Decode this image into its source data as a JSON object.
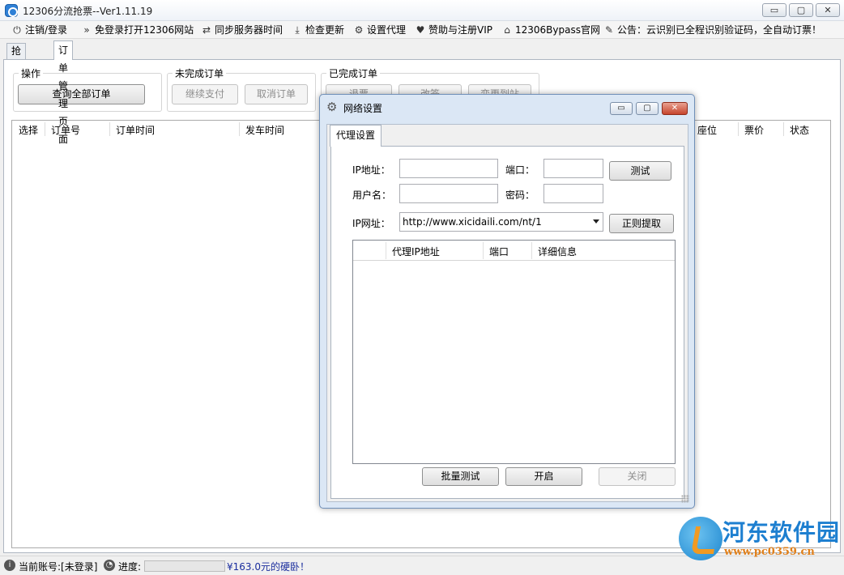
{
  "window": {
    "title": "12306分流抢票--Ver1.11.19",
    "min_glyph": "▭",
    "max_glyph": "▢",
    "close_glyph": "✕"
  },
  "toolbar": {
    "items": [
      {
        "icon": "⏻",
        "label": "注销/登录"
      },
      {
        "icon": "»",
        "label": "免登录打开12306网站"
      },
      {
        "icon": "⇄",
        "label": "同步服务器时间"
      },
      {
        "icon": "⤓",
        "label": "检查更新"
      },
      {
        "icon": "⚙",
        "label": "设置代理"
      },
      {
        "icon": "♥",
        "label": "赞助与注册VIP"
      },
      {
        "icon": "⌂",
        "label": "12306Bypass官网"
      },
      {
        "icon": "✎",
        "label": "公告：云识别已全程识别验证码，全自动订票！"
      }
    ]
  },
  "tabs": [
    {
      "label": "抢票页面",
      "active": false
    },
    {
      "label": "订单管理页面",
      "active": true
    }
  ],
  "order_page": {
    "ops_group": {
      "title": "操作",
      "query_all_button": "查询全部订单"
    },
    "unfinished_group": {
      "title": "未完成订单",
      "continue_pay_button": "继续支付",
      "cancel_order_button": "取消订单"
    },
    "finished_group": {
      "title": "已完成订单",
      "buttons": [
        "退票",
        "改签",
        "变更到站"
      ]
    },
    "columns_left": [
      "选择",
      "订单号",
      "订单时间",
      "发车时间"
    ],
    "columns_right": [
      "座位",
      "票价",
      "状态"
    ]
  },
  "statusbar": {
    "account_label": "当前账号:[未登录]",
    "progress_label": "进度:",
    "progress_value": 0,
    "marquee": "¥163.0元的硬卧！"
  },
  "dialog": {
    "title": "网络设置",
    "min_glyph": "▭",
    "max_glyph": "▢",
    "close_glyph": "✕",
    "tab_label": "代理设置",
    "ip_label": "IP地址：",
    "ip_value": "",
    "port_label": "端口：",
    "port_value": "",
    "test_button": "测试",
    "user_label": "用户名：",
    "user_value": "",
    "pass_label": "密码：",
    "pass_value": "",
    "ip_url_label": "IP网址：",
    "ip_url_value": "http://www.xicidaili.com/nt/1",
    "regex_button": "正则提取",
    "list_columns": [
      "代理IP地址",
      "端口",
      "详细信息"
    ],
    "batch_test_button": "批量测试",
    "enable_button": "开启",
    "close_button": "关闭"
  },
  "watermark": {
    "name": "河东软件园",
    "url": "www.pc0359.cn"
  }
}
